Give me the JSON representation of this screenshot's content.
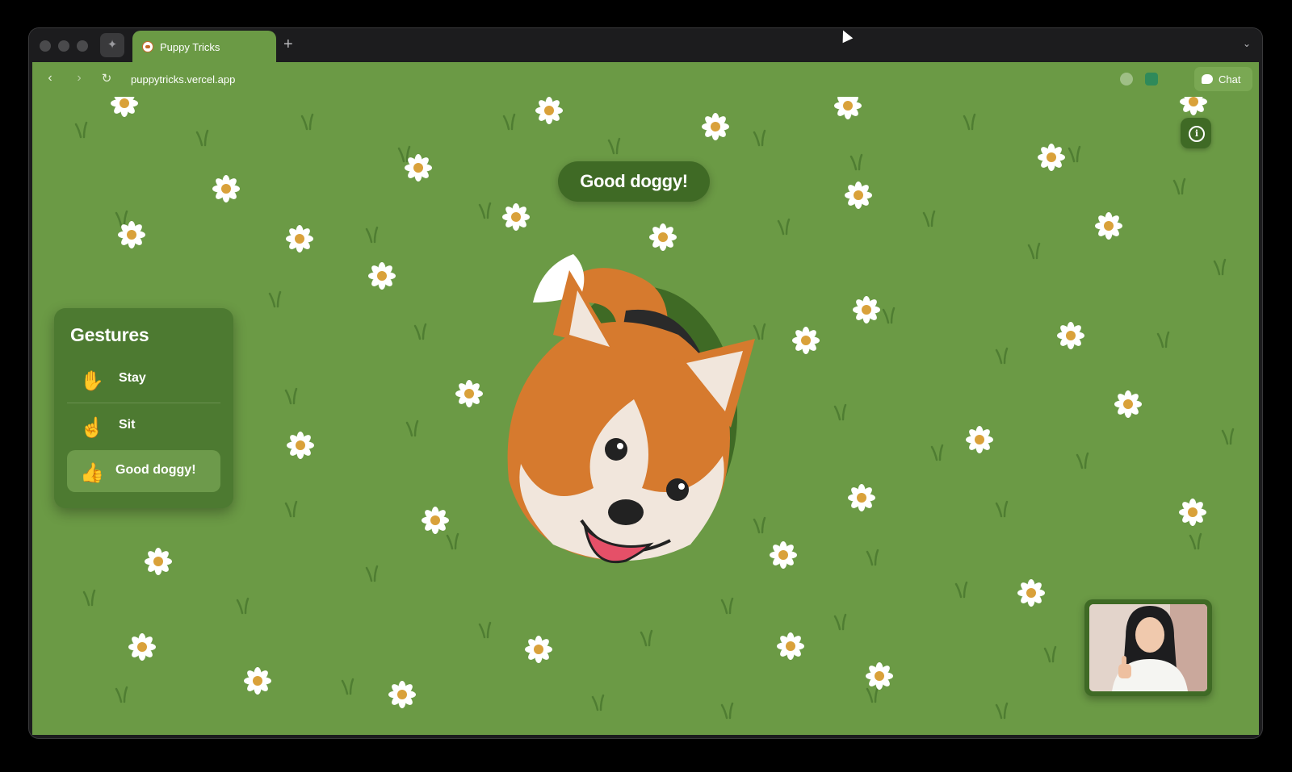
{
  "browser": {
    "tab_title": "Puppy Tricks",
    "new_tab_symbol": "+",
    "url": "puppytricks.vercel.app",
    "chat_label": "Chat",
    "icons": [
      "back-icon",
      "forward-icon",
      "reload-icon",
      "sidebar-pin-icon",
      "extension-icon",
      "chat-icon"
    ]
  },
  "app": {
    "toast": "Good doggy!",
    "gestures_title": "Gestures",
    "gestures": [
      {
        "emoji": "✋",
        "label": "Stay",
        "active": false
      },
      {
        "emoji": "☝",
        "label": "Sit",
        "active": false
      },
      {
        "emoji": "👍",
        "label": "Good doggy!",
        "active": true
      }
    ],
    "info_symbol": "i"
  },
  "colors": {
    "grass": "#6b9a45",
    "panel": "#4d7a31",
    "toast": "#3f6a25",
    "corgi_orange": "#d67a2e"
  }
}
